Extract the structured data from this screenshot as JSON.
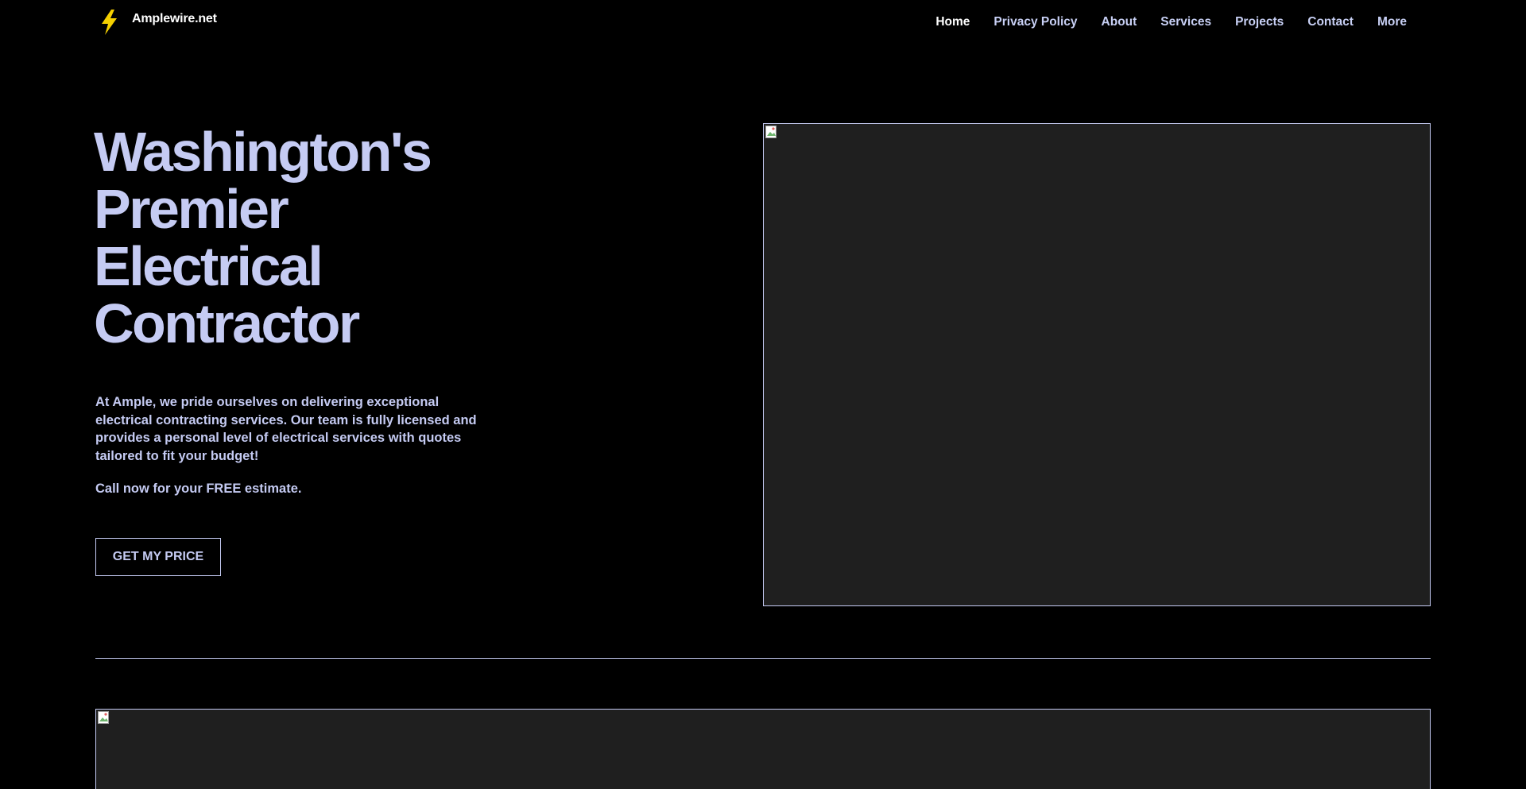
{
  "header": {
    "logo_text": "Amplewire.net",
    "logo_icon": "lightning-bolt-icon",
    "nav": [
      {
        "label": "Home",
        "active": true
      },
      {
        "label": "Privacy Policy",
        "active": false
      },
      {
        "label": "About",
        "active": false
      },
      {
        "label": "Services",
        "active": false
      },
      {
        "label": "Projects",
        "active": false
      },
      {
        "label": "Contact",
        "active": false
      },
      {
        "label": "More",
        "active": false
      }
    ]
  },
  "hero": {
    "title_lines": [
      "Washington's",
      "Premier",
      "Electrical",
      "Contractor"
    ],
    "body_lines": [
      "At Ample, we pride ourselves on delivering exceptional",
      "electrical contracting services. Our team is fully licensed and",
      "provides a personal level of electrical services with quotes",
      "tailored to fit your budget!"
    ],
    "cta_text": "Call now for your FREE estimate.",
    "cta_button": "GET MY PRICE",
    "image_icon": "broken-image-icon"
  },
  "bottom": {
    "image_icon": "broken-image-icon"
  },
  "colors": {
    "background": "#000000",
    "accent": "#c5cbf3",
    "placeholder": "#1f1f1f",
    "logo": "#f5d000"
  }
}
